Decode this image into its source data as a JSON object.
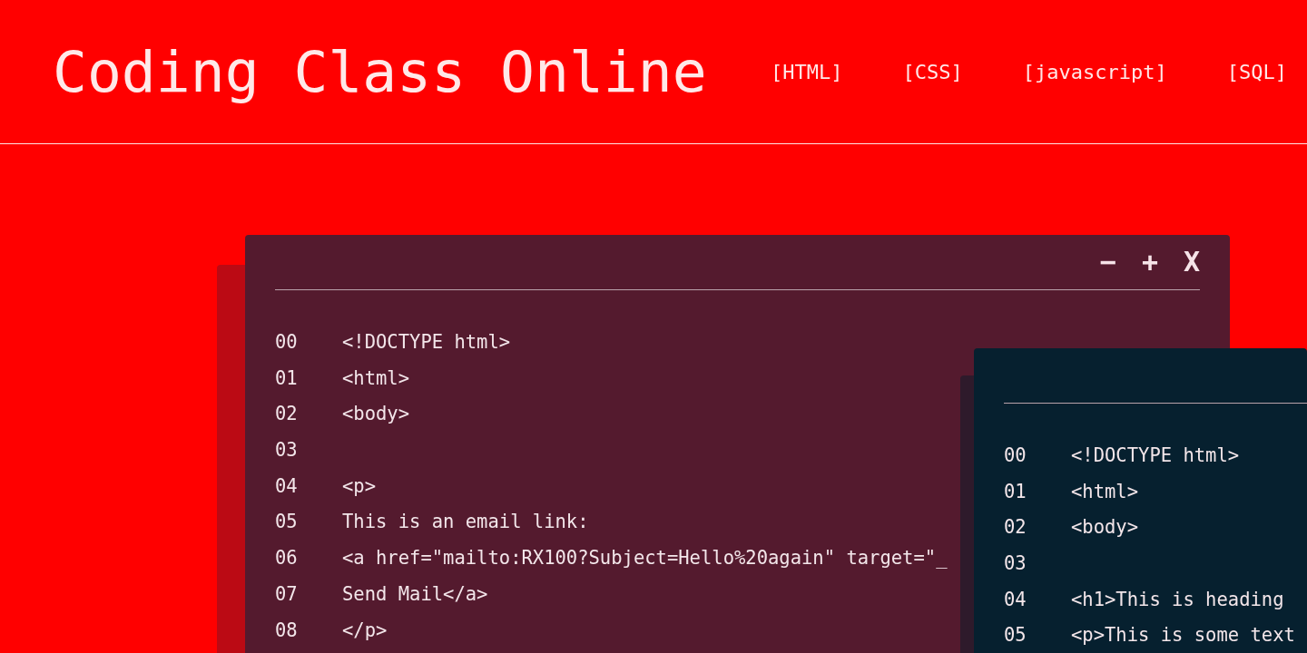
{
  "header": {
    "title": "Coding Class Online",
    "nav": [
      "[HTML]",
      "[CSS]",
      "[javascript]",
      "[SQL]"
    ]
  },
  "windows": [
    {
      "color": "#541a2e",
      "controls": [
        "−",
        "+",
        "X"
      ],
      "lines": [
        {
          "number": "00",
          "code": "<!DOCTYPE html>"
        },
        {
          "number": "01",
          "code": "<html>"
        },
        {
          "number": "02",
          "code": "<body>"
        },
        {
          "number": "03"
        },
        {
          "number": "04",
          "code": "<p>"
        },
        {
          "number": "05",
          "code": "This is an email link:"
        },
        {
          "number": "06",
          "code": "<a href=\"mailto:RX100?Subject=Hello%20again\" target=\"_"
        },
        {
          "number": "07",
          "code": "Send Mail</a>"
        },
        {
          "number": "08",
          "code": "</p>"
        }
      ]
    },
    {
      "color": "#06202f",
      "lines": [
        {
          "number": "00",
          "code": "<!DOCTYPE html>"
        },
        {
          "number": "01",
          "code": "<html>"
        },
        {
          "number": "02",
          "code": "<body>"
        },
        {
          "number": "03"
        },
        {
          "number": "04",
          "code": "<h1>This is heading"
        },
        {
          "number": "05",
          "code": "<p>This is some text"
        }
      ]
    }
  ]
}
